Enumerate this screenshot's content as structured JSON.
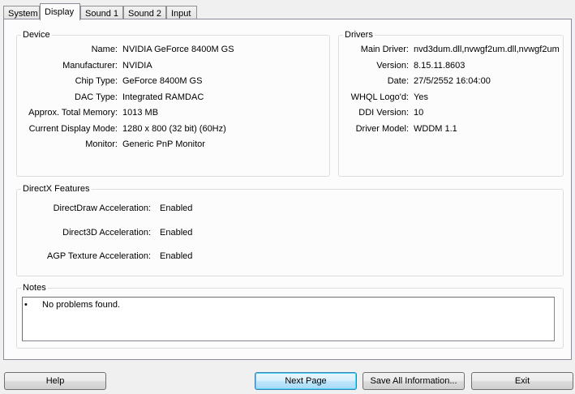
{
  "tabs": [
    {
      "label": "System"
    },
    {
      "label": "Display"
    },
    {
      "label": "Sound 1"
    },
    {
      "label": "Sound 2"
    },
    {
      "label": "Input"
    }
  ],
  "device": {
    "legend": "Device",
    "rows": [
      {
        "label": "Name:",
        "value": "NVIDIA GeForce 8400M GS"
      },
      {
        "label": "Manufacturer:",
        "value": "NVIDIA"
      },
      {
        "label": "Chip Type:",
        "value": "GeForce 8400M GS"
      },
      {
        "label": "DAC Type:",
        "value": "Integrated RAMDAC"
      },
      {
        "label": "Approx. Total Memory:",
        "value": "1013 MB"
      },
      {
        "label": "Current Display Mode:",
        "value": "1280 x 800 (32 bit) (60Hz)"
      },
      {
        "label": "Monitor:",
        "value": "Generic PnP Monitor"
      }
    ]
  },
  "drivers": {
    "legend": "Drivers",
    "rows": [
      {
        "label": "Main Driver:",
        "value": "nvd3dum.dll,nvwgf2um.dll,nvwgf2um"
      },
      {
        "label": "Version:",
        "value": "8.15.11.8603"
      },
      {
        "label": "Date:",
        "value": "27/5/2552 16:04:00"
      },
      {
        "label": "WHQL Logo'd:",
        "value": "Yes"
      },
      {
        "label": "DDI Version:",
        "value": "10"
      },
      {
        "label": "Driver Model:",
        "value": "WDDM 1.1"
      }
    ]
  },
  "directx": {
    "legend": "DirectX Features",
    "rows": [
      {
        "label": "DirectDraw Acceleration:",
        "value": "Enabled"
      },
      {
        "label": "Direct3D Acceleration:",
        "value": "Enabled"
      },
      {
        "label": "AGP Texture Acceleration:",
        "value": "Enabled"
      }
    ]
  },
  "notes": {
    "legend": "Notes",
    "bullet": "•",
    "items": [
      "No problems found."
    ]
  },
  "buttons": {
    "help": "Help",
    "next_page": "Next Page",
    "save_all": "Save All Information...",
    "exit": "Exit"
  }
}
